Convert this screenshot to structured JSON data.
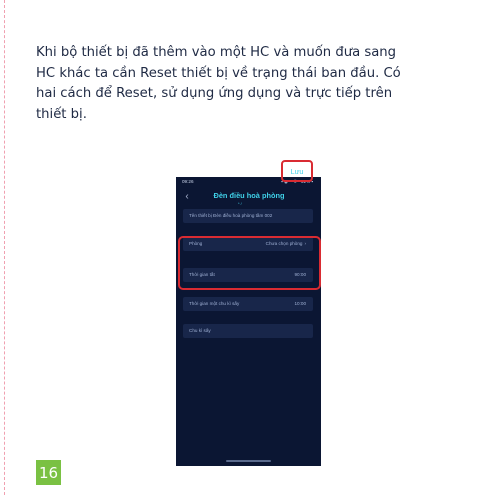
{
  "paragraph_lines": [
    "Khi bộ thiết bị đã thêm vào một HC và muốn đưa sang",
    "HC khác ta cần Reset thiết bị về trạng thái ban đầu. Có",
    "hai cách để Reset, sử dụng ứng dụng và trực tiếp trên",
    "thiết bị."
  ],
  "page_number": "16",
  "phone": {
    "status_time": "09:26",
    "status_right": "▪ ◉ ⁵⁶ ll ⁴ 62% ▪",
    "title": "Đèn điều hoà phòng",
    "subtitle": "* /",
    "save_label": "Lưu",
    "name_field": "Tên thiết bị Đèn điều hoà phòng tầm 002",
    "room_label": "Phòng",
    "room_value": "Chưa chọn phòng",
    "off_time_label": "Thời gian tắt",
    "off_time_value": "90:00",
    "cycle_time_label": "Thời gian một chu kì sấy",
    "cycle_time_value": "10:00",
    "cycle_label": "Chu kì sấy"
  },
  "colors": {
    "page_badge": "#7ac143",
    "highlight_red": "#d92b32",
    "phone_bg": "#0b1633",
    "accent_cyan": "#3fd0e8"
  }
}
